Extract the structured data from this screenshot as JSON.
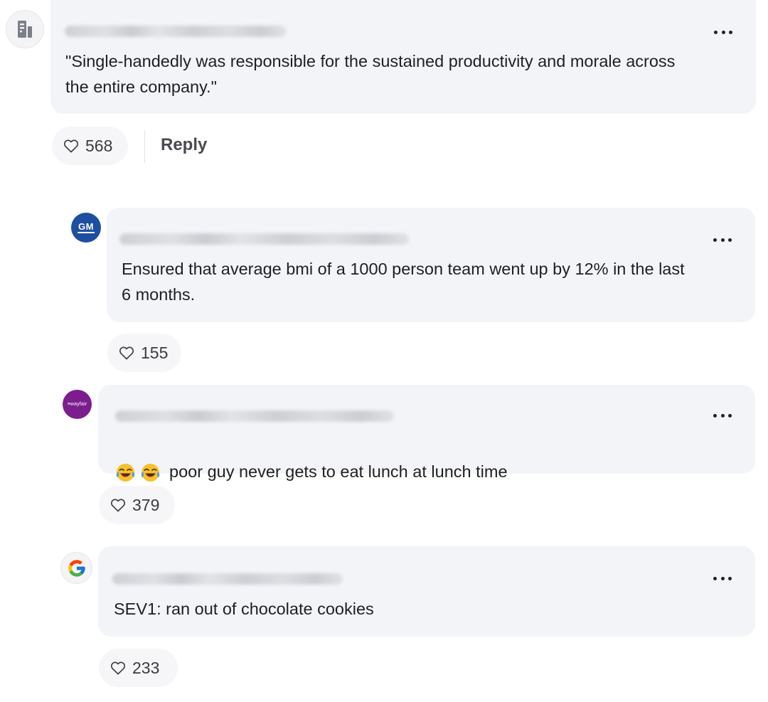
{
  "comments": [
    {
      "avatar": "building-icon",
      "text": "\"Single-handedly was responsible for the sustained productivity and morale across\nthe entire company.\"",
      "likes": "568",
      "reply_label": "Reply"
    },
    {
      "avatar": "gm-logo",
      "avatar_text": "GM",
      "avatar_color": "#1d4fa0",
      "text": "Ensured that average bmi of a 1000 person team went up by 12% in the last\n6 months.",
      "likes": "155"
    },
    {
      "avatar": "wayfair-logo",
      "avatar_text": "≡wayfair",
      "avatar_color": "#7c1d8e",
      "emojis": [
        "tears-of-joy-emoji",
        "tears-of-joy-emoji"
      ],
      "text": "poor guy never gets to eat lunch at lunch time",
      "likes": "379"
    },
    {
      "avatar": "google-logo",
      "avatar_text": "G",
      "text": "SEV1: ran out of chocolate cookies",
      "likes": "233"
    }
  ],
  "colors": {
    "bubble_bg": "#f3f4f8",
    "text": "#1f1f23",
    "like_pill_bg": "#f6f6f8"
  }
}
